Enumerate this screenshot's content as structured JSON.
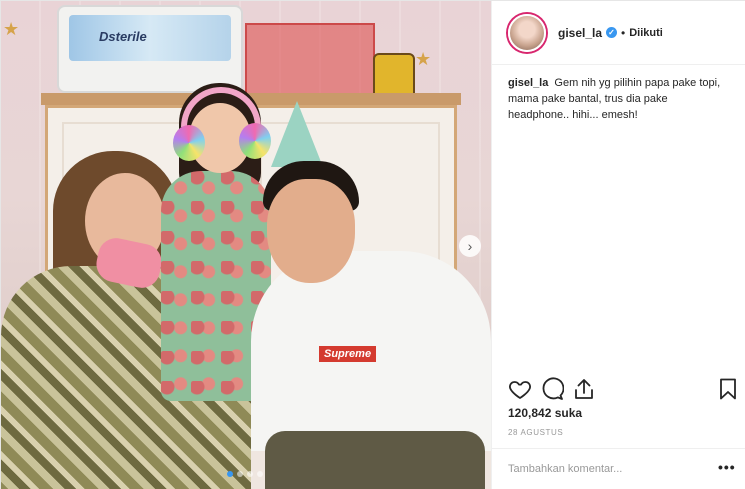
{
  "post": {
    "username": "gisel_la",
    "follow_status": "Diikuti",
    "separator": "•",
    "verified_badge": "verified-badge-icon",
    "caption_user": "gisel_la",
    "caption_text": "Gem nih yg pilihin papa pake topi, mama pake bantal, trus dia pake headphone.. hihi... emesh!",
    "likes_text": "120,842 suka",
    "date_text": "28 AGUSTUS",
    "comment_placeholder": "Tambahkan komentar...",
    "more_label": "•••",
    "next_label": "›"
  },
  "photo": {
    "sterilizer_brand": "Dsterile",
    "shirt_logo": "Supreme",
    "carousel_dots": 4,
    "active_dot": 0
  },
  "icons": {
    "like": "heart-icon",
    "comment": "comment-icon",
    "share": "share-icon",
    "save": "bookmark-icon",
    "next": "chevron-right-icon"
  },
  "colors": {
    "accent": "#3897f0",
    "text": "#262626",
    "muted": "#999999",
    "border": "#efefef"
  }
}
